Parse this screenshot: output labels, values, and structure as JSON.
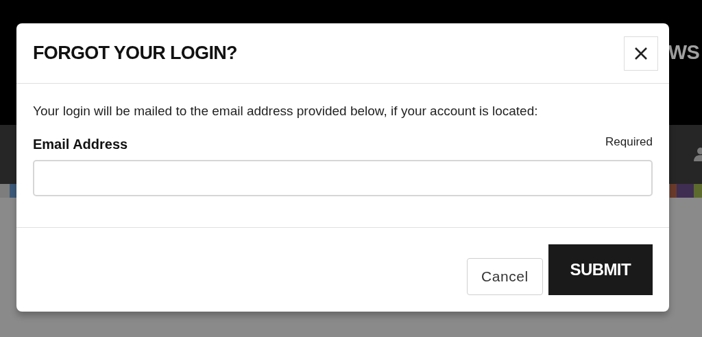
{
  "background": {
    "nav_text": "WS"
  },
  "dialog": {
    "title": "FORGOT YOUR LOGIN?",
    "message": "Your login will be mailed to the email address provided below, if your account is located:",
    "field": {
      "label": "Email Address",
      "requirement": "Required"
    },
    "buttons": [
      {
        "kind": "secondary",
        "label": "Cancel"
      },
      {
        "kind": "primary",
        "label": "SUBMIT"
      }
    ]
  }
}
